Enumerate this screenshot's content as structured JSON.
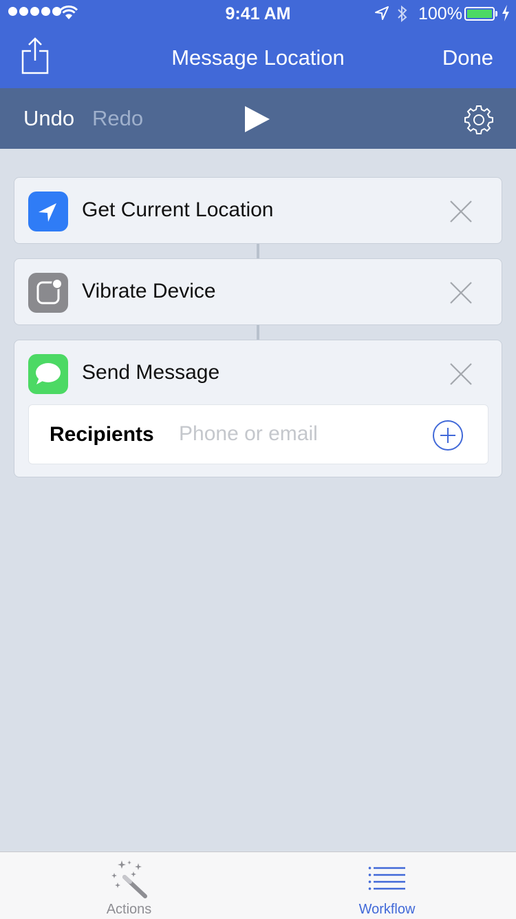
{
  "status_bar": {
    "time": "9:41 AM",
    "battery_percent": "100%",
    "signal_bars": 5,
    "battery_level": 1.0
  },
  "nav": {
    "title": "Message Location",
    "done_label": "Done",
    "share_icon": "share-icon"
  },
  "toolbar": {
    "undo_label": "Undo",
    "redo_label": "Redo",
    "play_icon": "play-icon",
    "settings_icon": "gear-icon"
  },
  "actions": [
    {
      "label": "Get Current Location",
      "icon": "location-arrow-icon",
      "icon_color": "#2f7cf6"
    },
    {
      "label": "Vibrate Device",
      "icon": "home-button-icon",
      "icon_color": "#8a8a8e"
    },
    {
      "label": "Send Message",
      "icon": "messages-icon",
      "icon_color": "#4cd964"
    }
  ],
  "send_message": {
    "recipients_label": "Recipients",
    "recipients_placeholder": "Phone or email",
    "recipients_value": ""
  },
  "tabbar": {
    "actions_label": "Actions",
    "workflow_label": "Workflow",
    "active_tab": "Workflow"
  },
  "colors": {
    "nav_blue": "#4169d8",
    "toolbar_slate": "#4f6893",
    "background": "#d9dfe8"
  }
}
